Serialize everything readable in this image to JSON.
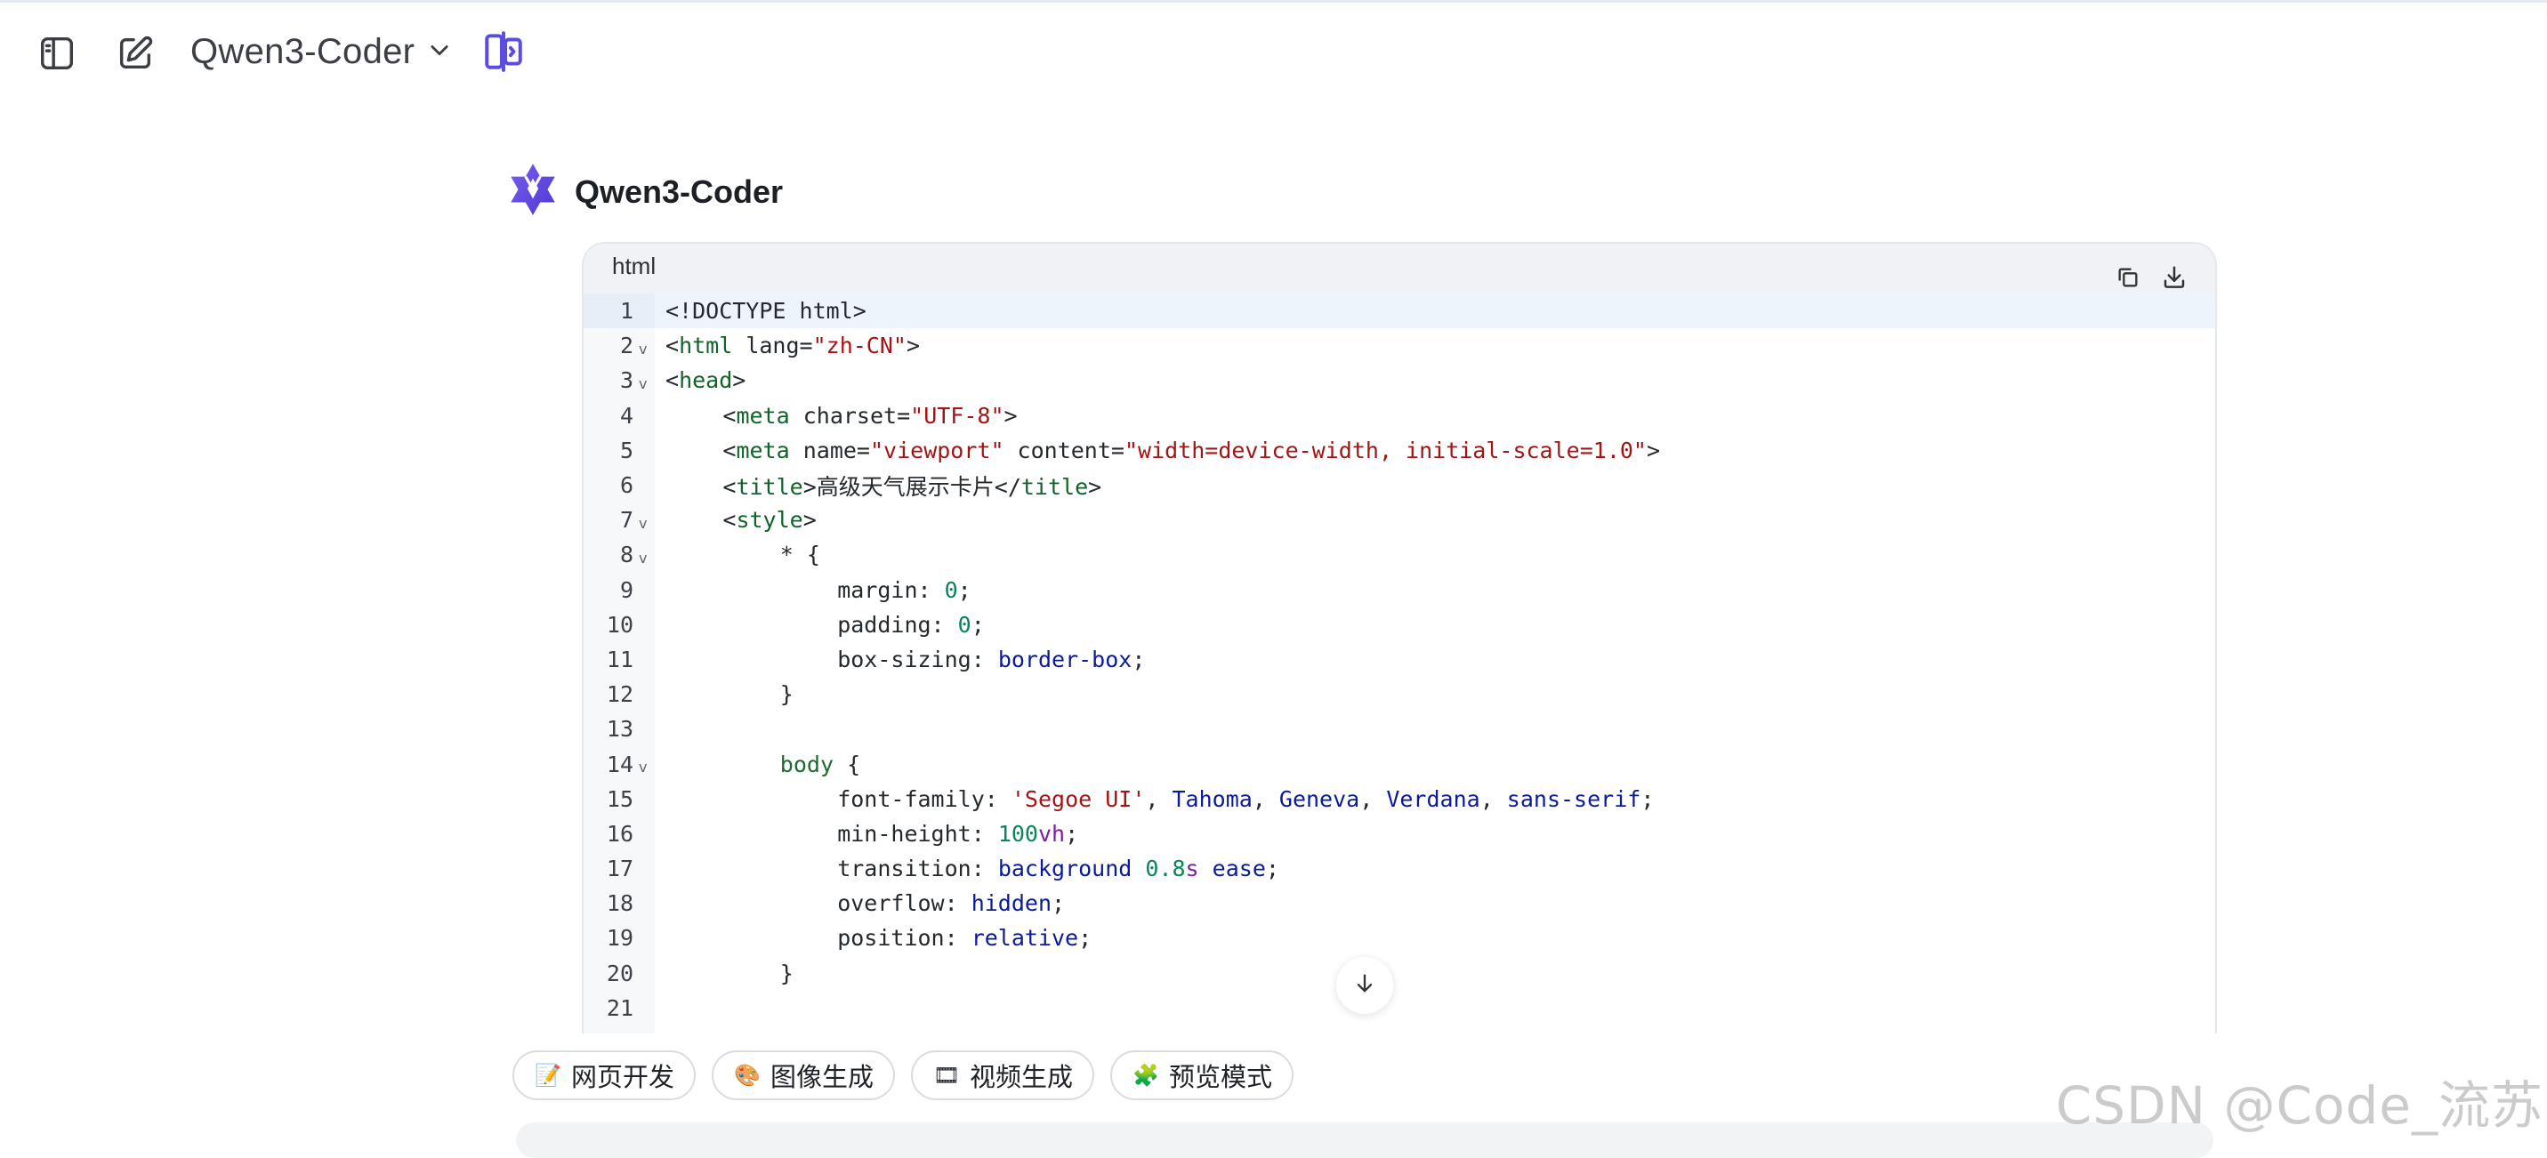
{
  "header": {
    "model_name": "Qwen3-Coder",
    "sidebar_toggle_icon": "sidebar-panel-icon",
    "new_chat_icon": "edit-icon",
    "compare_icon": "split-compare-icon"
  },
  "assistant": {
    "name": "Qwen3-Coder",
    "avatar_icon": "qwen-logo-icon"
  },
  "code_block": {
    "language": "html",
    "copy_icon": "copy-icon",
    "download_icon": "download-icon",
    "lines": [
      {
        "n": "1",
        "fold": false,
        "indent": 0,
        "tokens": [
          [
            "t-txt",
            "<!DOCTYPE html>"
          ]
        ]
      },
      {
        "n": "2",
        "fold": true,
        "indent": 0,
        "tokens": [
          [
            "t-txt",
            "<"
          ],
          [
            "t-tag",
            "html"
          ],
          [
            "t-txt",
            " lang="
          ],
          [
            "t-str",
            "\"zh-CN\""
          ],
          [
            "t-txt",
            ">"
          ]
        ]
      },
      {
        "n": "3",
        "fold": true,
        "indent": 0,
        "tokens": [
          [
            "t-txt",
            "<"
          ],
          [
            "t-tag",
            "head"
          ],
          [
            "t-txt",
            ">"
          ]
        ]
      },
      {
        "n": "4",
        "fold": false,
        "indent": 4,
        "tokens": [
          [
            "t-txt",
            "<"
          ],
          [
            "t-tag",
            "meta"
          ],
          [
            "t-txt",
            " charset="
          ],
          [
            "t-str",
            "\"UTF-8\""
          ],
          [
            "t-txt",
            ">"
          ]
        ]
      },
      {
        "n": "5",
        "fold": false,
        "indent": 4,
        "tokens": [
          [
            "t-txt",
            "<"
          ],
          [
            "t-tag",
            "meta"
          ],
          [
            "t-txt",
            " name="
          ],
          [
            "t-str",
            "\"viewport\""
          ],
          [
            "t-txt",
            " content="
          ],
          [
            "t-str",
            "\"width=device-width, initial-scale=1.0\""
          ],
          [
            "t-txt",
            ">"
          ]
        ]
      },
      {
        "n": "6",
        "fold": false,
        "indent": 4,
        "tokens": [
          [
            "t-txt",
            "<"
          ],
          [
            "t-tag",
            "title"
          ],
          [
            "t-txt",
            ">高级天气展示卡片</"
          ],
          [
            "t-tag",
            "title"
          ],
          [
            "t-txt",
            ">"
          ]
        ]
      },
      {
        "n": "7",
        "fold": true,
        "indent": 4,
        "tokens": [
          [
            "t-txt",
            "<"
          ],
          [
            "t-tag",
            "style"
          ],
          [
            "t-txt",
            ">"
          ]
        ]
      },
      {
        "n": "8",
        "fold": true,
        "indent": 8,
        "tokens": [
          [
            "t-txt",
            "* {"
          ]
        ]
      },
      {
        "n": "9",
        "fold": false,
        "indent": 12,
        "tokens": [
          [
            "t-txt",
            "margin: "
          ],
          [
            "t-num",
            "0"
          ],
          [
            "t-txt",
            ";"
          ]
        ]
      },
      {
        "n": "10",
        "fold": false,
        "indent": 12,
        "tokens": [
          [
            "t-txt",
            "padding: "
          ],
          [
            "t-num",
            "0"
          ],
          [
            "t-txt",
            ";"
          ]
        ]
      },
      {
        "n": "11",
        "fold": false,
        "indent": 12,
        "tokens": [
          [
            "t-txt",
            "box-sizing: "
          ],
          [
            "t-val",
            "border-box"
          ],
          [
            "t-txt",
            ";"
          ]
        ]
      },
      {
        "n": "12",
        "fold": false,
        "indent": 8,
        "tokens": [
          [
            "t-txt",
            "}"
          ]
        ]
      },
      {
        "n": "13",
        "fold": false,
        "indent": 0,
        "tokens": [
          [
            "t-txt",
            ""
          ]
        ]
      },
      {
        "n": "14",
        "fold": true,
        "indent": 8,
        "tokens": [
          [
            "t-kw",
            "body"
          ],
          [
            "t-txt",
            " {"
          ]
        ]
      },
      {
        "n": "15",
        "fold": false,
        "indent": 12,
        "tokens": [
          [
            "t-txt",
            "font-family: "
          ],
          [
            "t-str",
            "'Segoe UI'"
          ],
          [
            "t-txt",
            ", "
          ],
          [
            "t-val",
            "Tahoma"
          ],
          [
            "t-txt",
            ", "
          ],
          [
            "t-val",
            "Geneva"
          ],
          [
            "t-txt",
            ", "
          ],
          [
            "t-val",
            "Verdana"
          ],
          [
            "t-txt",
            ", "
          ],
          [
            "t-val",
            "sans-serif"
          ],
          [
            "t-txt",
            ";"
          ]
        ]
      },
      {
        "n": "16",
        "fold": false,
        "indent": 12,
        "tokens": [
          [
            "t-txt",
            "min-height: "
          ],
          [
            "t-num",
            "100"
          ],
          [
            "t-unit",
            "vh"
          ],
          [
            "t-txt",
            ";"
          ]
        ]
      },
      {
        "n": "17",
        "fold": false,
        "indent": 12,
        "tokens": [
          [
            "t-txt",
            "transition: "
          ],
          [
            "t-val",
            "background"
          ],
          [
            "t-txt",
            " "
          ],
          [
            "t-num",
            "0.8"
          ],
          [
            "t-unit",
            "s"
          ],
          [
            "t-txt",
            " "
          ],
          [
            "t-val",
            "ease"
          ],
          [
            "t-txt",
            ";"
          ]
        ]
      },
      {
        "n": "18",
        "fold": false,
        "indent": 12,
        "tokens": [
          [
            "t-txt",
            "overflow: "
          ],
          [
            "t-val",
            "hidden"
          ],
          [
            "t-txt",
            ";"
          ]
        ]
      },
      {
        "n": "19",
        "fold": false,
        "indent": 12,
        "tokens": [
          [
            "t-txt",
            "position: "
          ],
          [
            "t-val",
            "relative"
          ],
          [
            "t-txt",
            ";"
          ]
        ]
      },
      {
        "n": "20",
        "fold": false,
        "indent": 8,
        "tokens": [
          [
            "t-txt",
            "}"
          ]
        ]
      },
      {
        "n": "21",
        "fold": false,
        "indent": 0,
        "tokens": [
          [
            "t-txt",
            ""
          ]
        ]
      }
    ]
  },
  "chips": [
    {
      "label": "网页开发",
      "emoji": "📝",
      "icon": "memo-icon"
    },
    {
      "label": "图像生成",
      "emoji": "🎨",
      "icon": "palette-icon"
    },
    {
      "label": "视频生成",
      "emoji": "🎞",
      "icon": "film-icon"
    },
    {
      "label": "预览模式",
      "emoji": "🧩",
      "icon": "puzzle-icon"
    }
  ],
  "watermark": "CSDN @Code_流苏"
}
